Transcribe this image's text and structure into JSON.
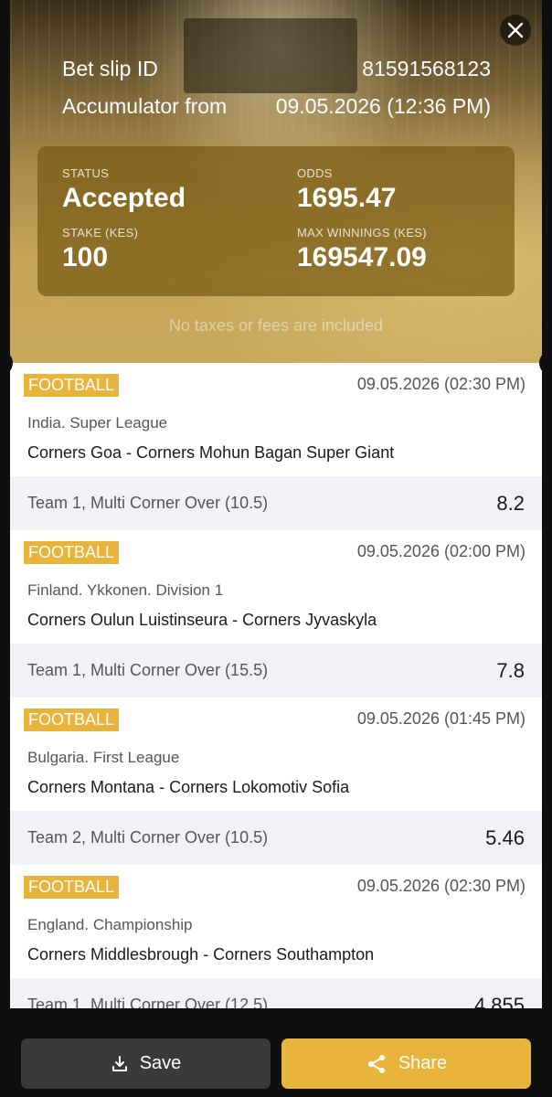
{
  "header": {
    "bet_slip_id_label": "Bet slip ID",
    "bet_slip_id": "81591568123",
    "accumulator_label": "Accumulator from",
    "accumulator_datetime": "09.05.2026 (12:36 PM)"
  },
  "summary": {
    "status_label": "STATUS",
    "status": "Accepted",
    "odds_label": "ODDS",
    "odds": "1695.47",
    "stake_label": "STAKE (KES)",
    "stake": "100",
    "max_winnings_label": "MAX WINNINGS (KES)",
    "max_winnings": "169547.09"
  },
  "note": "No taxes or fees are included",
  "events": [
    {
      "sport": "FOOTBALL",
      "datetime": "09.05.2026 (02:30 PM)",
      "league": "India. Super League",
      "match": "Corners Goa - Corners Mohun Bagan Super Giant",
      "market": "Team 1, Multi Corner Over (10.5)",
      "odd": "8.2"
    },
    {
      "sport": "FOOTBALL",
      "datetime": "09.05.2026 (02:00 PM)",
      "league": "Finland. Ykkonen. Division 1",
      "match": "Corners Oulun Luistinseura - Corners Jyvaskyla",
      "market": "Team 1, Multi Corner Over (15.5)",
      "odd": "7.8"
    },
    {
      "sport": "FOOTBALL",
      "datetime": "09.05.2026 (01:45 PM)",
      "league": "Bulgaria. First League",
      "match": "Corners Montana - Corners Lokomotiv Sofia",
      "market": "Team 2, Multi Corner Over (10.5)",
      "odd": "5.46"
    },
    {
      "sport": "FOOTBALL",
      "datetime": "09.05.2026 (02:30 PM)",
      "league": "England. Championship",
      "match": "Corners Middlesbrough - Corners Southampton",
      "market": "Team 1, Multi Corner Over (12.5)",
      "odd": "4.855"
    }
  ],
  "actions": {
    "save_label": "Save",
    "share_label": "Share"
  },
  "colors": {
    "accent": "#e9b43c",
    "summary_bg": "#785a14",
    "market_row_bg": "#f1f2f6",
    "save_bg": "#3a3a3c"
  },
  "icons": [
    "close-icon",
    "download-icon",
    "share-icon"
  ]
}
